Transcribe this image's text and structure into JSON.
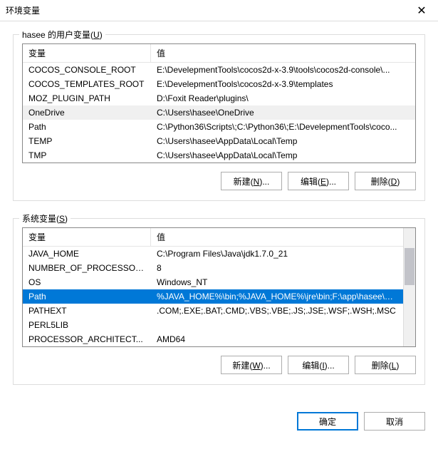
{
  "window": {
    "title": "环境变量"
  },
  "user_section": {
    "label": "hasee 的用户变量(",
    "label_key": "U",
    "label_after": ")",
    "headers": {
      "name": "变量",
      "value": "值"
    },
    "rows": [
      {
        "name": "COCOS_CONSOLE_ROOT",
        "value": "E:\\DevelepmentTools\\cocos2d-x-3.9\\tools\\cocos2d-console\\..."
      },
      {
        "name": "COCOS_TEMPLATES_ROOT",
        "value": "E:\\DevelepmentTools\\cocos2d-x-3.9\\templates"
      },
      {
        "name": "MOZ_PLUGIN_PATH",
        "value": "D:\\Foxit Reader\\plugins\\"
      },
      {
        "name": "OneDrive",
        "value": "C:\\Users\\hasee\\OneDrive"
      },
      {
        "name": "Path",
        "value": "C:\\Python36\\Scripts\\;C:\\Python36\\;E:\\DevelepmentTools\\coco..."
      },
      {
        "name": "TEMP",
        "value": "C:\\Users\\hasee\\AppData\\Local\\Temp"
      },
      {
        "name": "TMP",
        "value": "C:\\Users\\hasee\\AppData\\Local\\Temp"
      }
    ],
    "buttons": {
      "new": {
        "text": "新建(",
        "key": "N",
        "after": ")..."
      },
      "edit": {
        "text": "编辑(",
        "key": "E",
        "after": ")..."
      },
      "delete": {
        "text": "删除(",
        "key": "D",
        "after": ")"
      }
    }
  },
  "system_section": {
    "label": "系统变量(",
    "label_key": "S",
    "label_after": ")",
    "headers": {
      "name": "变量",
      "value": "值"
    },
    "rows": [
      {
        "name": "JAVA_HOME",
        "value": "C:\\Program Files\\Java\\jdk1.7.0_21"
      },
      {
        "name": "NUMBER_OF_PROCESSORS",
        "value": "8"
      },
      {
        "name": "OS",
        "value": "Windows_NT"
      },
      {
        "name": "Path",
        "value": "%JAVA_HOME%\\bin;%JAVA_HOME%\\jre\\bin;F:\\app\\hasee\\pr...",
        "selected": true
      },
      {
        "name": "PATHEXT",
        "value": ".COM;.EXE;.BAT;.CMD;.VBS;.VBE;.JS;.JSE;.WSF;.WSH;.MSC"
      },
      {
        "name": "PERL5LIB",
        "value": ""
      },
      {
        "name": "PROCESSOR_ARCHITECT...",
        "value": "AMD64"
      }
    ],
    "buttons": {
      "new": {
        "text": "新建(",
        "key": "W",
        "after": ")..."
      },
      "edit": {
        "text": "编辑(",
        "key": "I",
        "after": ")..."
      },
      "delete": {
        "text": "删除(",
        "key": "L",
        "after": ")"
      }
    }
  },
  "dialog_buttons": {
    "ok": "确定",
    "cancel": "取消"
  }
}
